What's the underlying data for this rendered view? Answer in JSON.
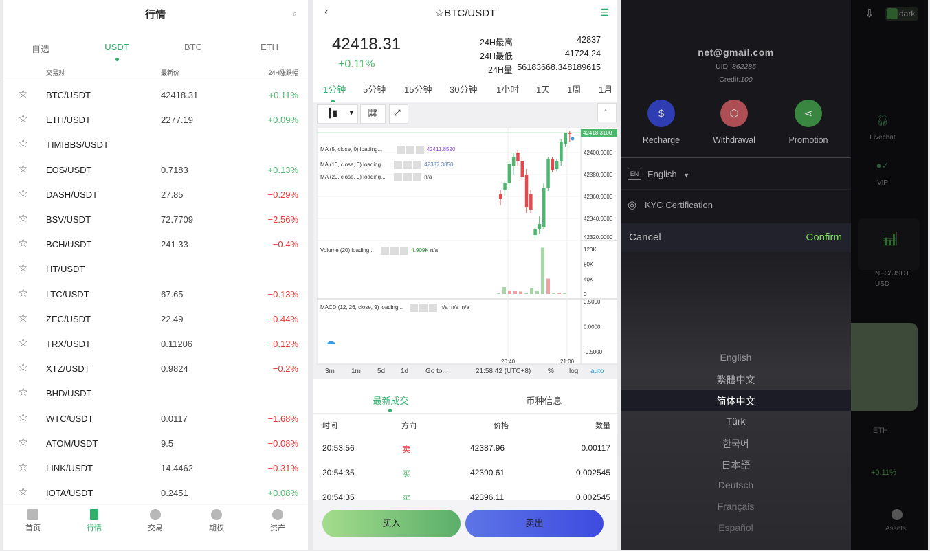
{
  "left": {
    "title": "行情",
    "tabs": [
      "自选",
      "USDT",
      "BTC",
      "ETH"
    ],
    "active_tab": 1,
    "columns": [
      "交易对",
      "最新价",
      "24H涨跌幅"
    ],
    "rows": [
      {
        "pair": "BTC/USDT",
        "price": "42418.31",
        "change": "+0.11%"
      },
      {
        "pair": "ETH/USDT",
        "price": "2277.19",
        "change": "+0.09%"
      },
      {
        "pair": "TIMIBBS/USDT",
        "price": "",
        "change": ""
      },
      {
        "pair": "EOS/USDT",
        "price": "0.7183",
        "change": "+0.13%"
      },
      {
        "pair": "DASH/USDT",
        "price": "27.85",
        "change": "−0.29%"
      },
      {
        "pair": "BSV/USDT",
        "price": "72.7709",
        "change": "−2.56%"
      },
      {
        "pair": "BCH/USDT",
        "price": "241.33",
        "change": "−0.4%"
      },
      {
        "pair": "HT/USDT",
        "price": "",
        "change": ""
      },
      {
        "pair": "LTC/USDT",
        "price": "67.65",
        "change": "−0.13%"
      },
      {
        "pair": "ZEC/USDT",
        "price": "22.49",
        "change": "−0.44%"
      },
      {
        "pair": "TRX/USDT",
        "price": "0.11206",
        "change": "−0.12%"
      },
      {
        "pair": "XTZ/USDT",
        "price": "0.9824",
        "change": "−0.2%"
      },
      {
        "pair": "BHD/USDT",
        "price": "",
        "change": ""
      },
      {
        "pair": "WTC/USDT",
        "price": "0.0117",
        "change": "−1.68%"
      },
      {
        "pair": "ATOM/USDT",
        "price": "9.5",
        "change": "−0.08%"
      },
      {
        "pair": "LINK/USDT",
        "price": "14.4462",
        "change": "−0.31%"
      },
      {
        "pair": "IOTA/USDT",
        "price": "0.2451",
        "change": "+0.08%"
      }
    ],
    "nav": [
      "首页",
      "行情",
      "交易",
      "期权",
      "资产"
    ],
    "active_nav": 1
  },
  "mid": {
    "title": "☆BTC/USDT",
    "price": "42418.31",
    "change": "+0.11%",
    "stats": [
      {
        "label": "24H最高",
        "value": "42837"
      },
      {
        "label": "24H最低",
        "value": "41724.24"
      },
      {
        "label": "24H量",
        "value": "56183668.348189615"
      }
    ],
    "intervals": [
      "1分钟",
      "5分钟",
      "15分钟",
      "30分钟",
      "1小时",
      "1天",
      "1周",
      "1月"
    ],
    "active_interval": 0,
    "chart": {
      "last_price": "42418.3100",
      "price_ticks": [
        "42400.0000",
        "42380.0000",
        "42360.0000",
        "42340.0000",
        "42320.0000"
      ],
      "ma": [
        {
          "label": "MA (5, close, 0) loading...",
          "value": "42411.8520",
          "color": "#8e44d8"
        },
        {
          "label": "MA (10, close, 0) loading...",
          "value": "42387.3850",
          "color": "#5a7ab8"
        },
        {
          "label": "MA (20, close, 0) loading...",
          "value": "n/a",
          "color": "#333"
        }
      ],
      "volume_label": "Volume (20) loading...",
      "volume_value": "4.909K",
      "volume_na": "n/a",
      "volume_ticks": [
        "120K",
        "80K",
        "40K",
        "0"
      ],
      "macd_label": "MACD (12, 26, close, 9) loading...",
      "macd_values": "n/a  n/a  n/a",
      "macd_ticks": [
        "0.5000",
        "0.0000",
        "-0.5000"
      ],
      "time_ticks": [
        "20:40",
        "21:00"
      ],
      "candles": [
        [
          42362,
          42366,
          42352,
          42358
        ],
        [
          42366,
          42374,
          42360,
          42372
        ],
        [
          42372,
          42392,
          42368,
          42390
        ],
        [
          42388,
          42400,
          42380,
          42396
        ],
        [
          42400,
          42402,
          42388,
          42392
        ],
        [
          42392,
          42396,
          42375,
          42378
        ],
        [
          42380,
          42385,
          42345,
          42350
        ],
        [
          42362,
          42366,
          42345,
          42348
        ],
        [
          42325,
          42332,
          42322,
          42330
        ],
        [
          42330,
          42342,
          42326,
          42335
        ],
        [
          42332,
          42372,
          42330,
          42368
        ],
        [
          42368,
          42396,
          42365,
          42394
        ],
        [
          42394,
          42396,
          42382,
          42384
        ],
        [
          42385,
          42394,
          42383,
          42392
        ],
        [
          42392,
          42412,
          42388,
          42410
        ],
        [
          42408,
          42418,
          42405,
          42418
        ],
        [
          42418,
          42420,
          42410,
          42417
        ]
      ],
      "volumes": [
        [
          2,
          1
        ],
        [
          20,
          1
        ],
        [
          10,
          0
        ],
        [
          8,
          0
        ],
        [
          7,
          0
        ],
        [
          2,
          1
        ],
        [
          18,
          1
        ],
        [
          10,
          1
        ],
        [
          135,
          1
        ],
        [
          45,
          0
        ],
        [
          3,
          1
        ],
        [
          3,
          0
        ],
        [
          3,
          1
        ]
      ],
      "bottom": [
        "3m",
        "1m",
        "5d",
        "1d",
        "Go to..."
      ],
      "clock": "21:58:42 (UTC+8)",
      "options": [
        "%",
        "log",
        "auto"
      ]
    },
    "tabs": [
      "最新成交",
      "币种信息"
    ],
    "active_tab": 0,
    "trade_columns": [
      "时间",
      "方向",
      "价格",
      "数量"
    ],
    "trades": [
      {
        "time": "20:53:56",
        "side": "卖",
        "price": "42387.96",
        "qty": "0.00117"
      },
      {
        "time": "20:54:35",
        "side": "买",
        "price": "42390.61",
        "qty": "0.002545"
      },
      {
        "time": "20:54:35",
        "side": "买",
        "price": "42396.11",
        "qty": "0.002545"
      }
    ],
    "buy": "买入",
    "sell": "卖出"
  },
  "right": {
    "theme_label": "dark",
    "email": "net@gmail.com",
    "uid_label": "UID:",
    "uid": "862285",
    "credit_label": "Credit:",
    "credit": "100",
    "actions": [
      {
        "label": "Recharge",
        "color": "#3344cc"
      },
      {
        "label": "Withdrawal",
        "color": "#c8585e"
      },
      {
        "label": "Promotion",
        "color": "#3f9a47"
      }
    ],
    "language_badge": "EN",
    "language": "English",
    "kyc": "KYC Certification",
    "cancel": "Cancel",
    "confirm": "Confirm",
    "languages": [
      "English",
      "繁體中文",
      "简体中文",
      "Türk",
      "한국어",
      "日本語",
      "Deutsch",
      "Français",
      "Español"
    ],
    "selected_language": 2,
    "side": {
      "livechat": "Livechat",
      "vip": "VIP",
      "nfc_pair": "NFC/USDT",
      "nfc_unit": "USD",
      "eth": "ETH",
      "eth_change": "+0.11%",
      "assets": "Assets"
    }
  },
  "colors": {
    "accent": "#2fb06b",
    "up": "#4cb86f",
    "down": "#e53935",
    "confirm": "#7ee05a"
  }
}
